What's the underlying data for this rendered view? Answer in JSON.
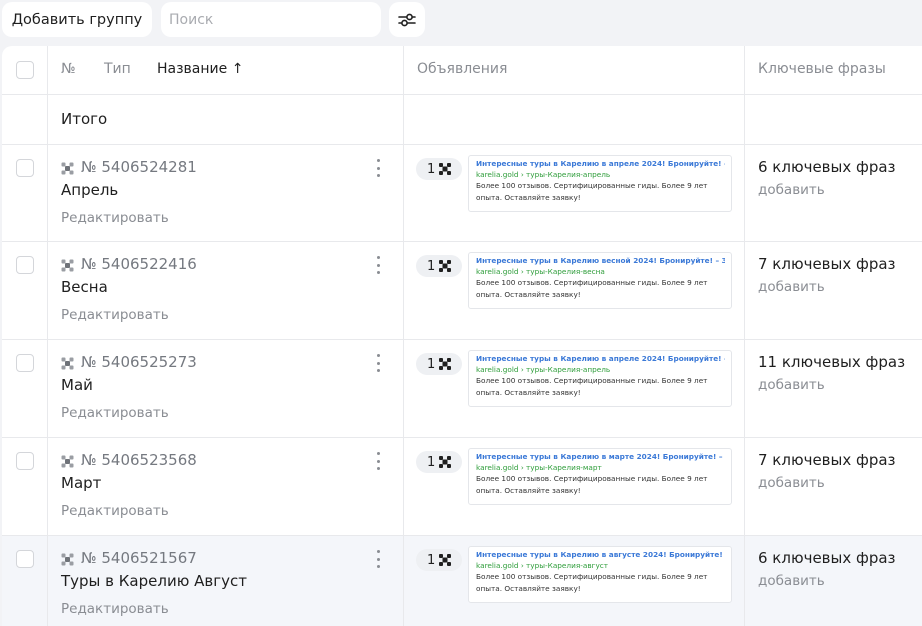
{
  "toolbar": {
    "add_group_label": "Добавить группу",
    "search_placeholder": "Поиск",
    "filter_icon": "sliders-icon"
  },
  "table": {
    "headers": {
      "number": "№",
      "type": "Тип",
      "name": "Название ↑",
      "ads": "Объявления",
      "keywords": "Ключевые фразы"
    },
    "total_label": "Итого",
    "rows": [
      {
        "id": "№ 5406524281",
        "name": "Апрель",
        "edit": "Редактировать",
        "ads_count": "1",
        "ad_title": "Интересные туры в Карелию в апреле 2024! Бронируйте! – ...",
        "ad_url": "karelia.gold › туры-Карелия-апрель",
        "ad_desc": "Более 100 отзывов. Сертифицированные гиды. Более 9 лет опыта. Оставляйте заявку!",
        "keywords": "6 ключевых фраз",
        "add": "добавить"
      },
      {
        "id": "№ 5406522416",
        "name": "Весна",
        "edit": "Редактировать",
        "ads_count": "1",
        "ad_title": "Интересные туры в Карелию весной 2024! Бронируйте! – З...",
        "ad_url": "karelia.gold › туры-Карелия-весна",
        "ad_desc": "Более 100 отзывов. Сертифицированные гиды. Более 9 лет опыта. Оставляйте заявку!",
        "keywords": "7 ключевых фраз",
        "add": "добавить"
      },
      {
        "id": "№ 5406525273",
        "name": "Май",
        "edit": "Редактировать",
        "ads_count": "1",
        "ad_title": "Интересные туры в Карелию в апреле 2024! Бронируйте! – ...",
        "ad_url": "karelia.gold › туры-Карелия-апрель",
        "ad_desc": "Более 100 отзывов. Сертифицированные гиды. Более 9 лет опыта. Оставляйте заявку!",
        "keywords": "11 ключевых фраз",
        "add": "добавить"
      },
      {
        "id": "№ 5406523568",
        "name": "Март",
        "edit": "Редактировать",
        "ads_count": "1",
        "ad_title": "Интересные туры в Карелию в марте 2024! Бронируйте! – З...",
        "ad_url": "karelia.gold › туры-Карелия-март",
        "ad_desc": "Более 100 отзывов. Сертифицированные гиды. Более 9 лет опыта. Оставляйте заявку!",
        "keywords": "7 ключевых фраз",
        "add": "добавить"
      },
      {
        "id": "№ 5406521567",
        "name": "Туры в Карелию Август",
        "edit": "Редактировать",
        "ads_count": "1",
        "ad_title": "Интересные туры в Карелию в августе 2024! Бронируйте! – ...",
        "ad_url": "karelia.gold › туры-Карелия-август",
        "ad_desc": "Более 100 отзывов. Сертифицированные гиды. Более 9 лет опыта. Оставляйте заявку!",
        "keywords": "6 ключевых фраз",
        "add": "добавить"
      }
    ]
  },
  "colors": {
    "background": "#f2f3f6",
    "ad_title": "#3b79d7",
    "ad_url": "#2e9d3a",
    "muted_text": "#8a8d93"
  }
}
